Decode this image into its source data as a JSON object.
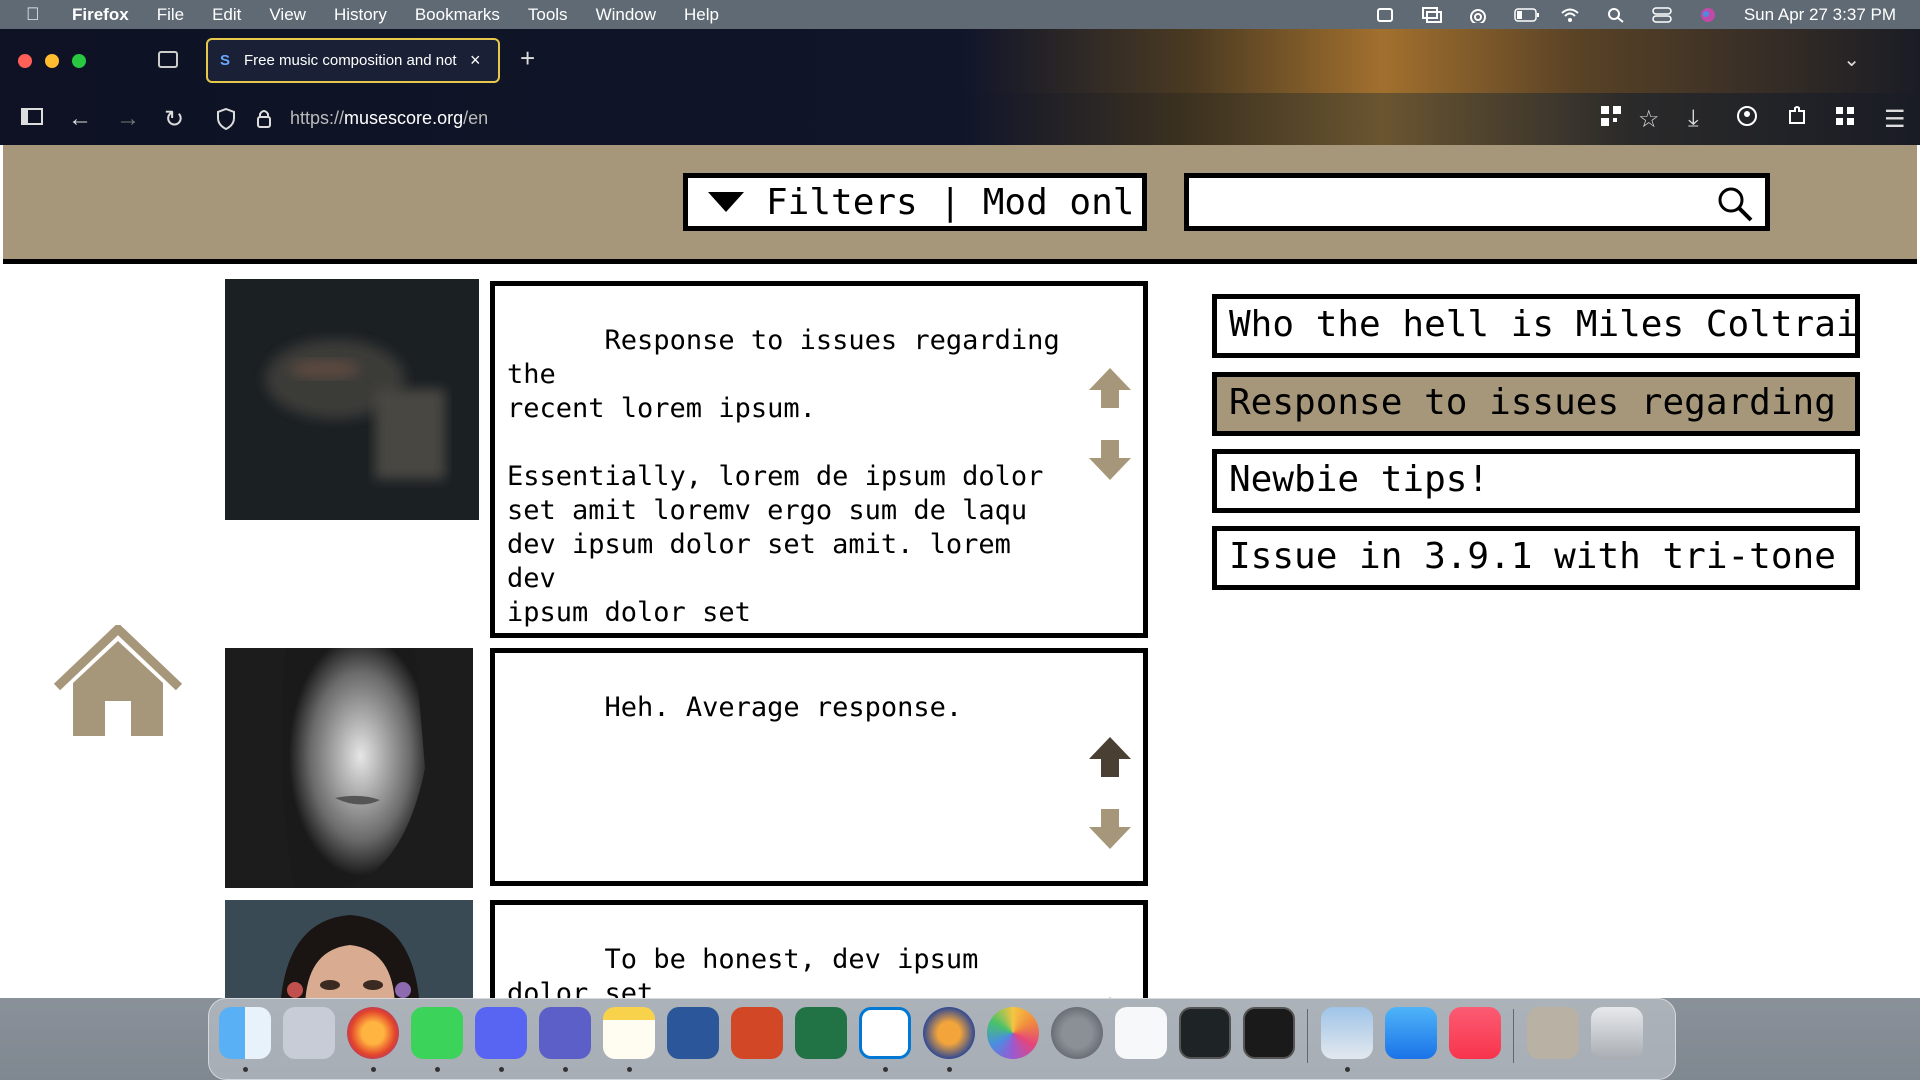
{
  "menubar": {
    "app": "Firefox",
    "items": [
      "File",
      "Edit",
      "View",
      "History",
      "Bookmarks",
      "Tools",
      "Window",
      "Help"
    ],
    "datetime": "Sun Apr 27  3:37 PM"
  },
  "browser": {
    "tab_title": "Free music composition and not",
    "tab_favicon": "S",
    "url_prefix": "https://",
    "url_domain": "musescore.org",
    "url_path": "/en"
  },
  "header": {
    "filters_label": "Filters | Mod onl",
    "search_value": ""
  },
  "posts": [
    {
      "text": "Response to issues regarding the\nrecent lorem ipsum.\n\nEssentially, lorem de ipsum dolor\nset amit loremv ergo sum de laqu\ndev ipsum dolor set amit. lorem dev\nipsum dolor set\namit lorem dev ipsum dolor set amit\nlorem dev ipsum dolor set amit\nfemeoa lys",
      "upvote_state": "neutral"
    },
    {
      "text": "Heh. Average response.",
      "upvote_state": "upvoted"
    },
    {
      "text": "To be honest, dev ipsum dolor set\namit lorem dev ipsum dolor dev\nipsum dolor set amit lorem",
      "upvote_state": "neutral"
    }
  ],
  "sidebar": {
    "threads": [
      {
        "label": "Who the hell is Miles Coltrai",
        "active": false
      },
      {
        "label": "Response to issues regarding",
        "active": true
      },
      {
        "label": "Newbie tips!",
        "active": false
      },
      {
        "label": "Issue in 3.9.1 with tri-tone",
        "active": false
      }
    ]
  },
  "colors": {
    "accent_tan": "#a6977a",
    "upvoted_dark": "#4a3f33"
  },
  "dock": {
    "apps": [
      "finder-icon",
      "launchpad-icon",
      "firefox-icon",
      "messages-icon",
      "discord-icon",
      "teams-icon",
      "notes-icon",
      "word-icon",
      "powerpoint-icon",
      "excel-icon",
      "vscode-icon",
      "audacity-icon",
      "photos-icon",
      "system-settings-icon",
      "freeform-icon",
      "activity-monitor-icon",
      "terminal-icon",
      "preview-icon",
      "mail-icon",
      "music-icon",
      "downloads-stack-icon",
      "trash-icon"
    ]
  }
}
